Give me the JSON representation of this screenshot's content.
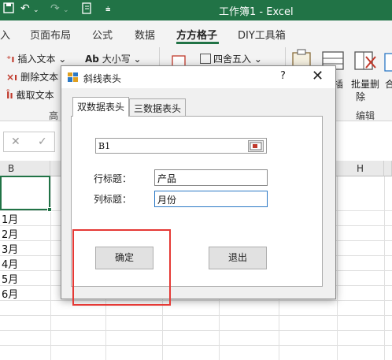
{
  "titlebar": {
    "title": "工作簿1  -  Excel",
    "undo_icon": "undo-icon",
    "redo_icon": "redo-icon",
    "colors": {
      "bar": "#217346"
    }
  },
  "tabs": {
    "items": [
      "入",
      "页面布局",
      "公式",
      "数据",
      "方方格子",
      "DIY工具箱"
    ],
    "active": "方方格子"
  },
  "ribbon": {
    "insert_text": "插入文本",
    "delete_text": "删除文本",
    "extract_text": "截取文本",
    "case": "大小写",
    "case_prefix": "Ab",
    "round": "四舍五入",
    "batch_insert": "插",
    "batch_delete_1": "批量删",
    "batch_delete_2": "除",
    "merge": "合",
    "group_left": "高",
    "group_edit": "编辑"
  },
  "formulabar": {
    "cancel": "✕",
    "enter": "✓"
  },
  "sheet": {
    "col_b": "B",
    "col_h": "H",
    "cells": [
      "1月",
      "2月",
      "3月",
      "4月",
      "5月",
      "6月"
    ]
  },
  "dialog": {
    "title": "斜线表头",
    "help": "?",
    "close": "✕",
    "tab1": "双数据表头",
    "tab2": "三数据表头",
    "cell_ref": "B1",
    "row_label": "行标题：",
    "row_value": "产品",
    "col_label": "列标题：",
    "col_value": "月份",
    "ok": "确定",
    "exit": "退出"
  }
}
